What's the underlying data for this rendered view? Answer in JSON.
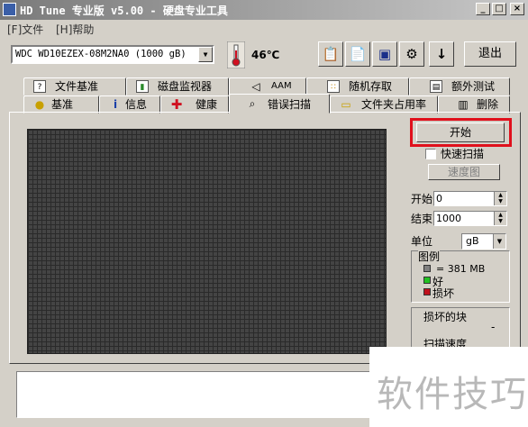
{
  "window": {
    "title": "HD Tune 专业版 v5.00 - 硬盘专业工具",
    "controls": [
      "_",
      "□",
      "×"
    ]
  },
  "menu": {
    "items": [
      "[F]文件",
      "[H]帮助"
    ]
  },
  "toolbar": {
    "drive": "WDC WD10EZEX-08M2NA0 (1000 gB)",
    "temperature": "46℃",
    "exit_label": "退出",
    "buttons": [
      "copy-icon",
      "paste-icon",
      "save-icon",
      "options-icon",
      "down-arrow-icon"
    ]
  },
  "tabs_top": [
    {
      "label": "文件基准",
      "icon": "file-benchmark-icon"
    },
    {
      "label": "磁盘监视器",
      "icon": "disk-monitor-icon"
    },
    {
      "label": "AAM",
      "icon": "speaker-icon"
    },
    {
      "label": "随机存取",
      "icon": "random-access-icon"
    },
    {
      "label": "额外测试",
      "icon": "extra-tests-icon"
    }
  ],
  "tabs_bottom": [
    {
      "label": "基准",
      "icon": "lightbulb-icon"
    },
    {
      "label": "信息",
      "icon": "info-icon"
    },
    {
      "label": "健康",
      "icon": "health-cross-icon"
    },
    {
      "label": "错误扫描",
      "icon": "magnifier-icon",
      "active": true
    },
    {
      "label": "文件夹占用率",
      "icon": "folder-icon"
    },
    {
      "label": "删除",
      "icon": "trash-icon"
    }
  ],
  "scan": {
    "start_label": "开始",
    "quick_scan_label": "快速扫描",
    "quick_scan_checked": false,
    "speed_map_label": "速度图",
    "start_field_label": "开始",
    "start_value": "0",
    "end_field_label": "结束",
    "end_value": "1000",
    "unit_label": "单位",
    "unit_value": "gB"
  },
  "legend": {
    "title": "图例",
    "block_size": "= 381 MB",
    "good": "好",
    "damaged": "损坏",
    "colors": {
      "block": "#808080",
      "good": "#22c022",
      "damaged": "#c0101c"
    }
  },
  "stats": {
    "damaged_blocks_label": "损坏的块",
    "damaged_blocks_value": "-",
    "scan_speed_label": "扫描速度"
  },
  "watermark": "软件技巧",
  "highlight_color": "#e0101c"
}
